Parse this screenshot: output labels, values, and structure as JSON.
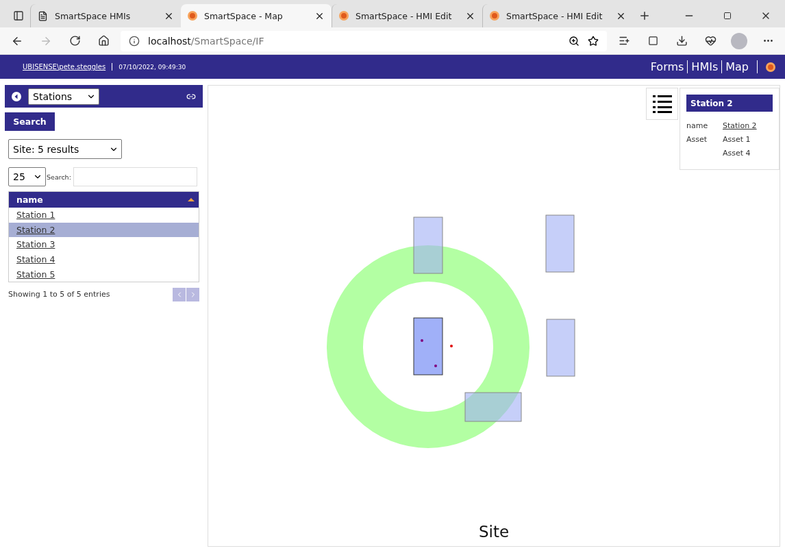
{
  "browser": {
    "tabs": [
      {
        "title": "SmartSpace HMIs",
        "kind": "page",
        "selected": false
      },
      {
        "title": "SmartSpace - Map",
        "kind": "app",
        "selected": true
      },
      {
        "title": "SmartSpace - HMI Edit",
        "kind": "app",
        "selected": false
      },
      {
        "title": "SmartSpace - HMI Edit",
        "kind": "app",
        "selected": false
      }
    ],
    "address": {
      "host": "localhost",
      "path": "/SmartSpace/IF"
    }
  },
  "header": {
    "user": "UBISENSE\\pete.steggles",
    "timestamp": "07/10/2022, 09:49:30",
    "nav": [
      "Forms",
      "HMIs",
      "Map"
    ]
  },
  "sidebar": {
    "type_select": "Stations",
    "search_button": "Search",
    "results_select": "Site: 5 results",
    "page_size": "25",
    "search_label": "Search:",
    "table": {
      "column": "name",
      "rows": [
        {
          "name": "Station 1",
          "selected": false
        },
        {
          "name": "Station 2",
          "selected": true
        },
        {
          "name": "Station 3",
          "selected": false
        },
        {
          "name": "Station 4",
          "selected": false
        },
        {
          "name": "Station 5",
          "selected": false
        }
      ]
    },
    "footer": "Showing 1 to 5 of 5 entries"
  },
  "map": {
    "label": "Site"
  },
  "info": {
    "title": "Station 2",
    "rows": [
      {
        "key": "name",
        "values": [
          "Station 2"
        ],
        "link": true
      },
      {
        "key": "Asset",
        "values": [
          "Asset 1",
          "Asset 4"
        ],
        "link": false
      }
    ]
  }
}
